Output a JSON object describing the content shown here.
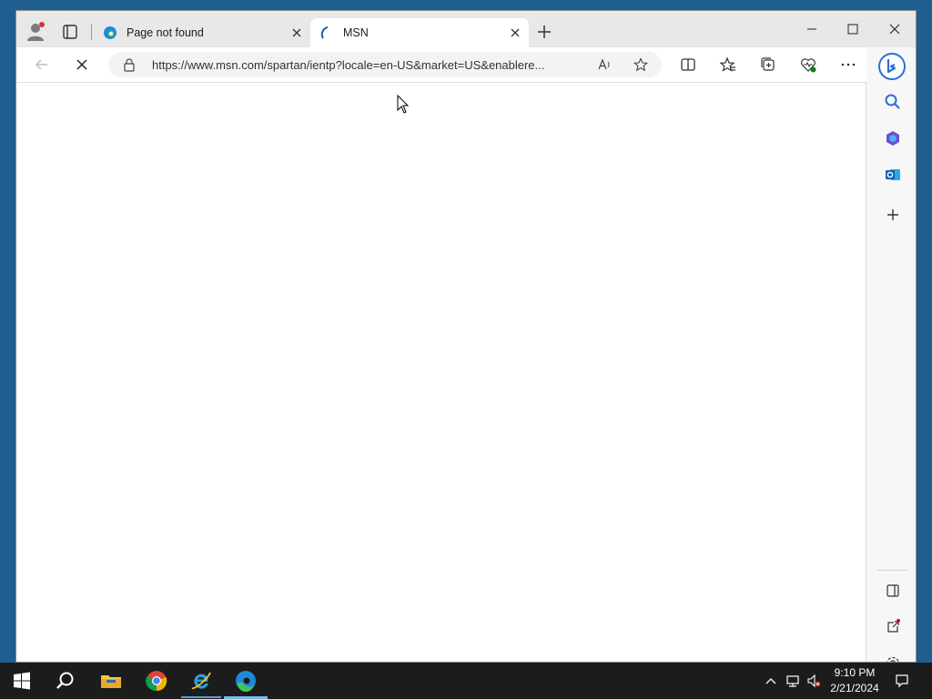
{
  "browser": {
    "tabs": [
      {
        "title": "Page not found",
        "favicon": "edge-icon",
        "active": false
      },
      {
        "title": "MSN",
        "favicon": "msn-loading-icon",
        "active": true
      }
    ],
    "address": {
      "url": "https://www.msn.com/spartan/ientp?locale=en-US&market=US&enablere..."
    },
    "toolbar_icons": [
      "back-icon",
      "stop-loading-icon",
      "lock-icon",
      "read-aloud-icon",
      "favorite-star-icon",
      "split-screen-icon",
      "favorites-icon",
      "collections-icon",
      "browser-essentials-icon",
      "more-icon",
      "bing-chat-icon"
    ],
    "sidebar_icons": [
      "search-icon",
      "copilot-icon",
      "outlook-icon",
      "add-icon",
      "hide-sidebar-icon",
      "open-external-icon",
      "settings-icon"
    ]
  },
  "taskbar": {
    "apps": [
      "start-icon",
      "search-icon",
      "file-explorer-icon",
      "chrome-icon",
      "internet-explorer-icon",
      "edge-icon"
    ],
    "clock": {
      "time": "9:10 PM",
      "date": "2/21/2024"
    }
  },
  "colors": {
    "tabstrip": "#e8e8e8",
    "taskbar": "#1c1c1c",
    "accent": "#0078d4",
    "notification_dot": "#d13438"
  }
}
